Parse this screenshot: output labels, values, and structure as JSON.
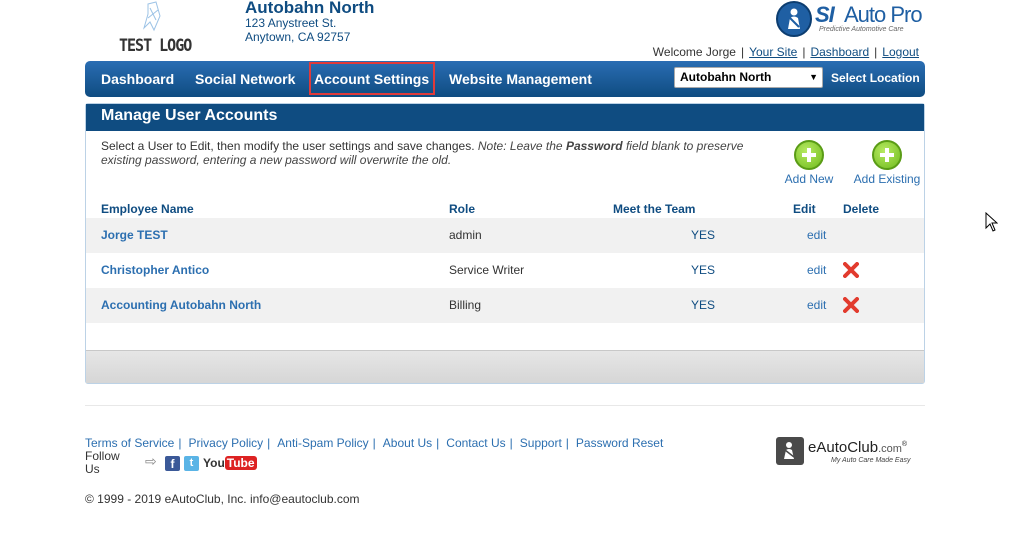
{
  "header": {
    "logo_text": "TEST LOGO",
    "dealer_name": "Autobahn North",
    "address_line1": "123 Anystreet St.",
    "address_line2": "Anytown,  CA 92757",
    "brand_si": "SI",
    "brand_autopro": "Auto Pro",
    "brand_tagline": "Predictive Automotive Care",
    "welcome": "Welcome Jorge",
    "links": [
      "Your Site",
      "Dashboard",
      "Logout"
    ]
  },
  "nav": {
    "items": [
      "Dashboard",
      "Social Network",
      "Account Settings",
      "Website Management"
    ],
    "highlighted": "Account Settings",
    "location_value": "Autobahn North",
    "location_label": "Select Location"
  },
  "panel": {
    "title": "Manage User Accounts",
    "instr_plain": "Select a User to Edit, then modify the user settings and save changes. ",
    "instr_note_a": "Note: Leave the ",
    "instr_note_bold": "Password",
    "instr_note_b": " field blank to preserve existing password, entering a new password will overwrite the old.",
    "add_new": "Add New",
    "add_existing": "Add Existing",
    "columns": [
      "Employee Name",
      "Role",
      "Meet the Team",
      "Edit",
      "Delete"
    ],
    "rows": [
      {
        "name": "Jorge TEST",
        "role": "admin",
        "meet": "YES",
        "edit": "edit",
        "delete": false
      },
      {
        "name": "Christopher Antico",
        "role": "Service Writer",
        "meet": "YES",
        "edit": "edit",
        "delete": true
      },
      {
        "name": "Accounting Autobahn North",
        "role": "Billing",
        "meet": "YES",
        "edit": "edit",
        "delete": true
      }
    ]
  },
  "footer": {
    "links": [
      "Terms of Service",
      "Privacy Policy",
      "Anti-Spam Policy",
      "About Us",
      "Contact Us",
      "Support",
      "Password Reset"
    ],
    "follow": "Follow Us",
    "social": {
      "fb": "f",
      "tw": "t",
      "yt_you": "You",
      "yt_tube": "Tube"
    },
    "copyright": "© 1999 - 2019 eAutoClub, Inc. info@eautoclub.com",
    "eauto_name": "eAutoClub",
    "eauto_com": ".com",
    "eauto_reg": "®",
    "eauto_tag": "My Auto Care Made Easy"
  },
  "colors": {
    "primary": "#0f4c81",
    "link": "#2c6fb0",
    "highlight_border": "#e03a3a",
    "add_green": "#6fbb1c",
    "delete_red": "#e23b2e"
  },
  "icons": [
    "logo-sketch-icon",
    "seatbelt-icon",
    "plus-icon",
    "delete-x-icon",
    "arrow-right-icon",
    "facebook-icon",
    "twitter-icon",
    "youtube-icon",
    "eautoclub-icon",
    "mouse-cursor-icon"
  ]
}
